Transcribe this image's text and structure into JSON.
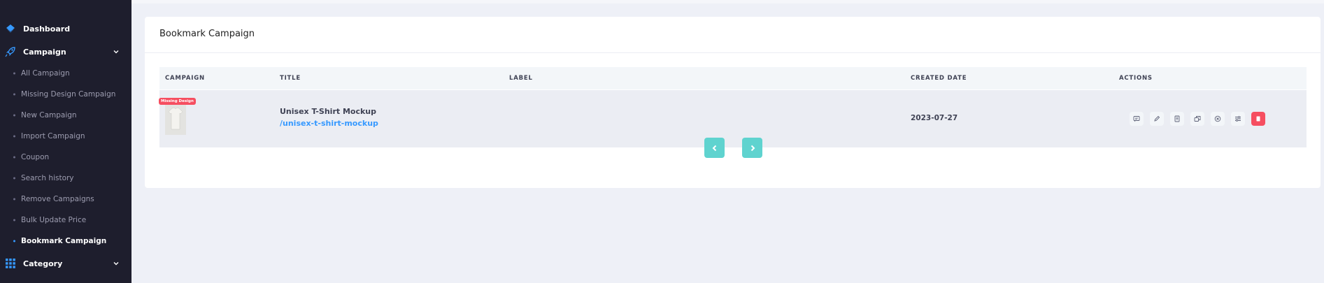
{
  "sidebar": {
    "items": [
      {
        "label": "Dashboard",
        "icon": "layers-icon"
      },
      {
        "label": "Campaign",
        "icon": "rocket-icon"
      },
      {
        "label": "Category",
        "icon": "grid-icon"
      }
    ],
    "campaign_sub": [
      "All Campaign",
      "Missing Design Campaign",
      "New Campaign",
      "Import Campaign",
      "Coupon",
      "Search history",
      "Remove Campaigns",
      "Bulk Update Price",
      "Bookmark Campaign"
    ],
    "active_sub": "Bookmark Campaign"
  },
  "page": {
    "title": "Bookmark Campaign"
  },
  "table": {
    "headers": [
      "CAMPAIGN",
      "TITLE",
      "LABEL",
      "CREATED DATE",
      "ACTIONS"
    ],
    "rows": [
      {
        "badge": "Missing Design",
        "title": "Unisex T-Shirt Mockup",
        "slug": "/unisex-t-shirt-mockup",
        "label": "",
        "created_date": "2023-07-27"
      }
    ],
    "actions": [
      "bookmark-icon",
      "edit-icon",
      "copy-icon",
      "duplicate-icon",
      "close-circle-icon",
      "settings-icon",
      "delete-icon"
    ]
  },
  "colors": {
    "sidebar_bg": "#1e1e2d",
    "accent": "#3699ff",
    "danger": "#f64e60",
    "pager": "#5fd3cf"
  }
}
